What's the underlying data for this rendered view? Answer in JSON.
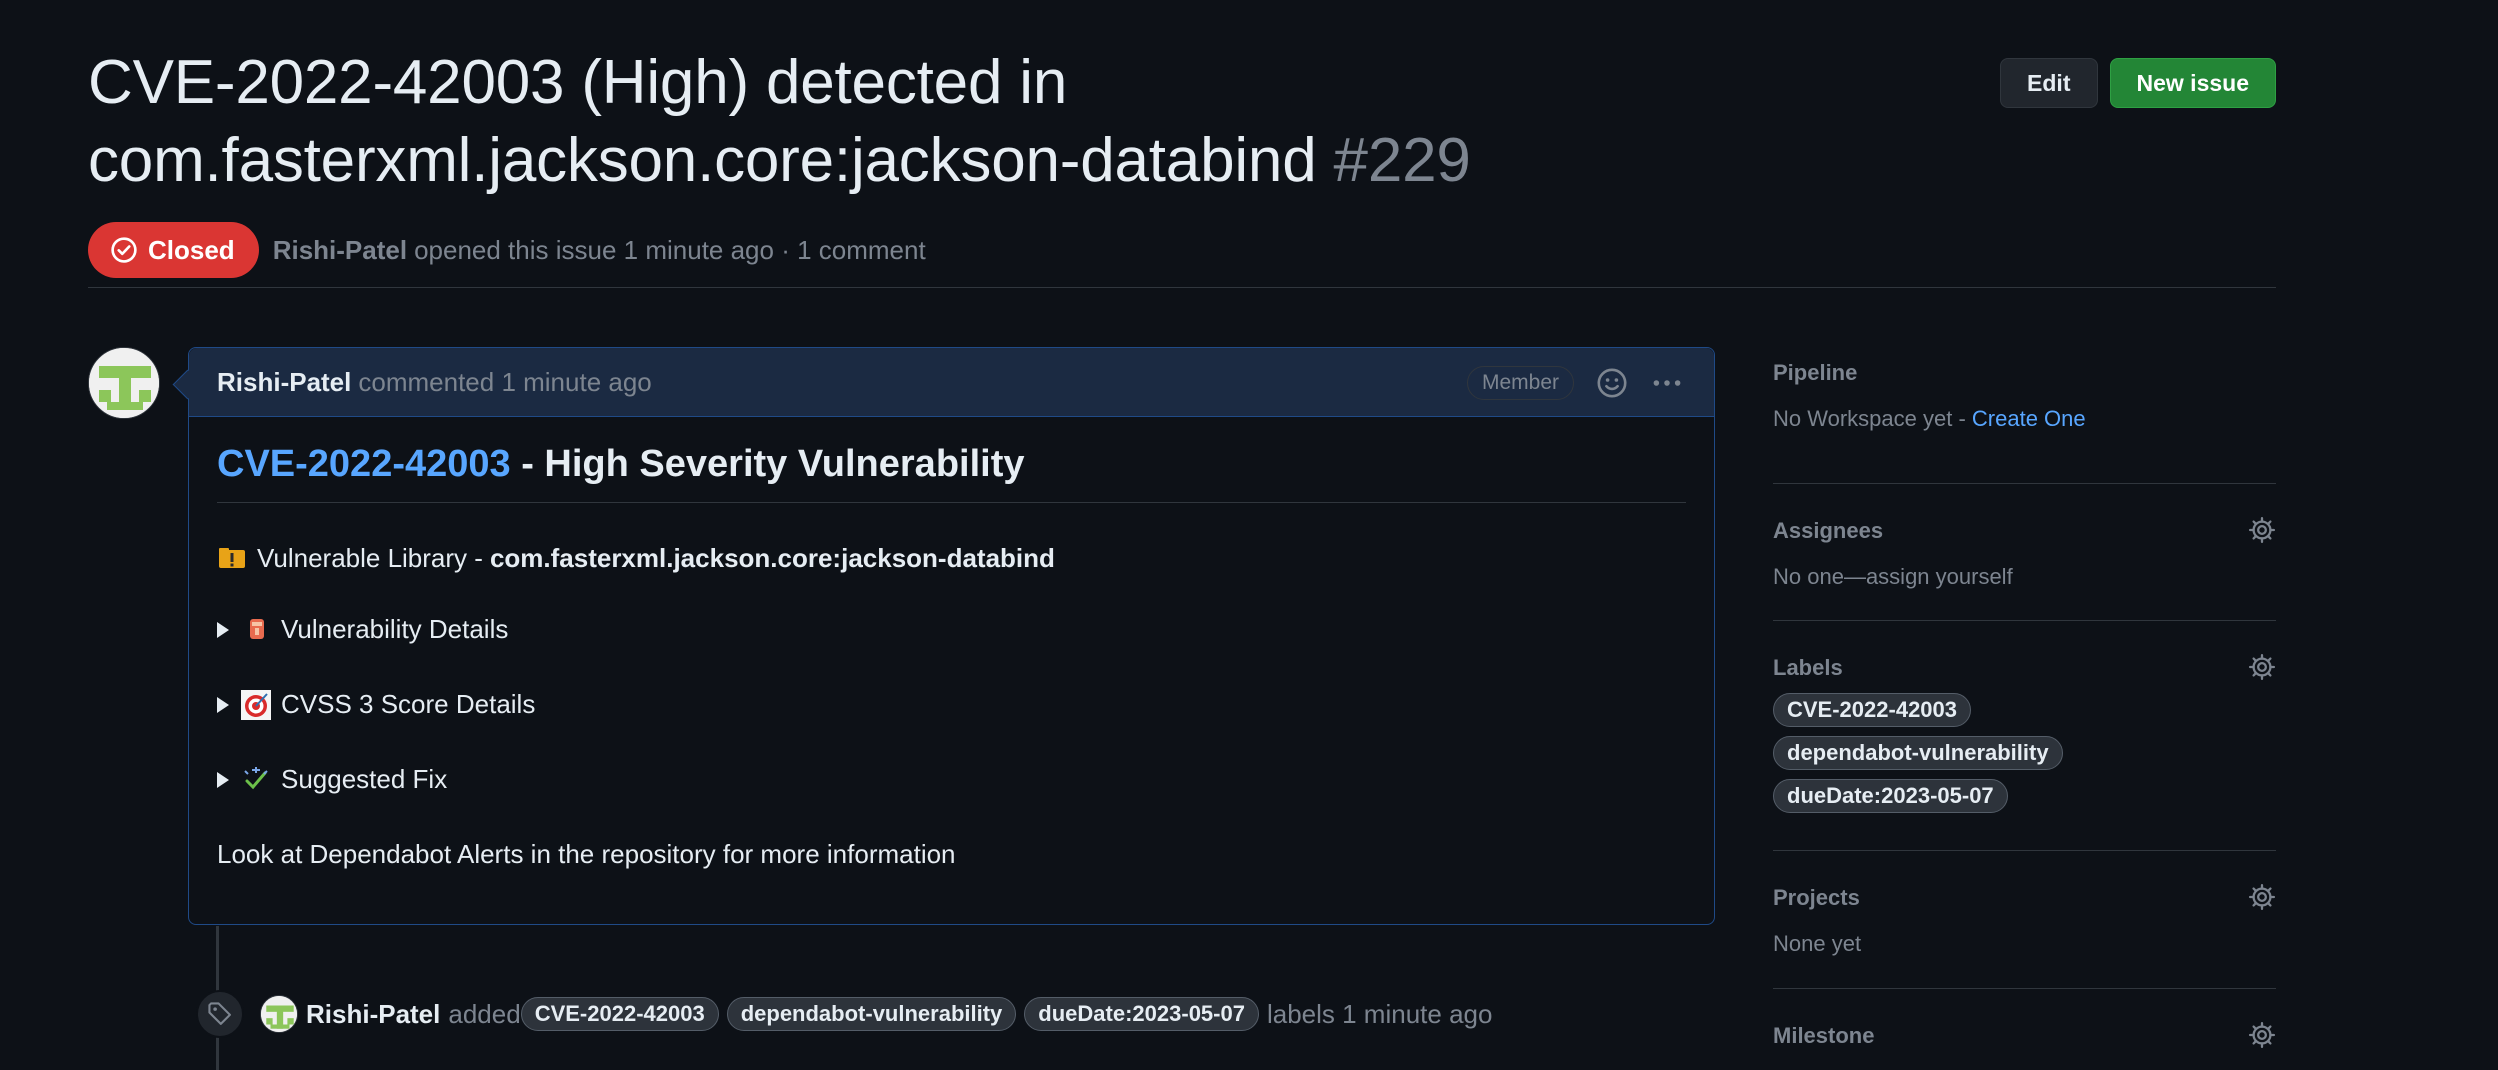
{
  "issue": {
    "title": "CVE-2022-42003 (High) detected in com.fasterxml.jackson.core:jackson-databind",
    "number": "#229",
    "state": "Closed",
    "author": "Rishi-Patel",
    "opened_text": "opened this issue 1 minute ago · 1 comment"
  },
  "header_actions": {
    "edit": "Edit",
    "new_issue": "New issue"
  },
  "comment": {
    "author": "Rishi-Patel",
    "action": "commented 1 minute ago",
    "role_badge": "Member",
    "title_link": "CVE-2022-42003",
    "title_rest": " - High Severity Vulnerability",
    "vuln_lib_prefix": "Vulnerable Library -",
    "vuln_lib_name": "com.fasterxml.jackson.core:jackson-databind",
    "details": [
      {
        "label": "Vulnerability Details",
        "icon": "vulnerability-emoji-icon"
      },
      {
        "label": "CVSS 3 Score Details",
        "icon": "target-emoji-icon"
      },
      {
        "label": "Suggested Fix",
        "icon": "sparkle-check-emoji-icon"
      }
    ],
    "footer": "Look at Dependabot Alerts in the repository for more information"
  },
  "event": {
    "author": "Rishi-Patel",
    "action": "added",
    "labels": [
      "CVE-2022-42003",
      "dependabot-vulnerability",
      "dueDate:2023-05-07"
    ],
    "suffix": "labels 1 minute ago"
  },
  "sidebar": {
    "pipeline": {
      "title": "Pipeline",
      "value": "No Workspace yet -",
      "link": "Create One"
    },
    "assignees": {
      "title": "Assignees",
      "value": "No one—assign yourself"
    },
    "labels": {
      "title": "Labels",
      "items": [
        "CVE-2022-42003",
        "dependabot-vulnerability",
        "dueDate:2023-05-07"
      ]
    },
    "projects": {
      "title": "Projects",
      "value": "None yet"
    },
    "milestone": {
      "title": "Milestone"
    }
  },
  "colors": {
    "closed": "#da3633",
    "link": "#58a6ff",
    "green_button": "#238636",
    "background": "#0d1117"
  }
}
